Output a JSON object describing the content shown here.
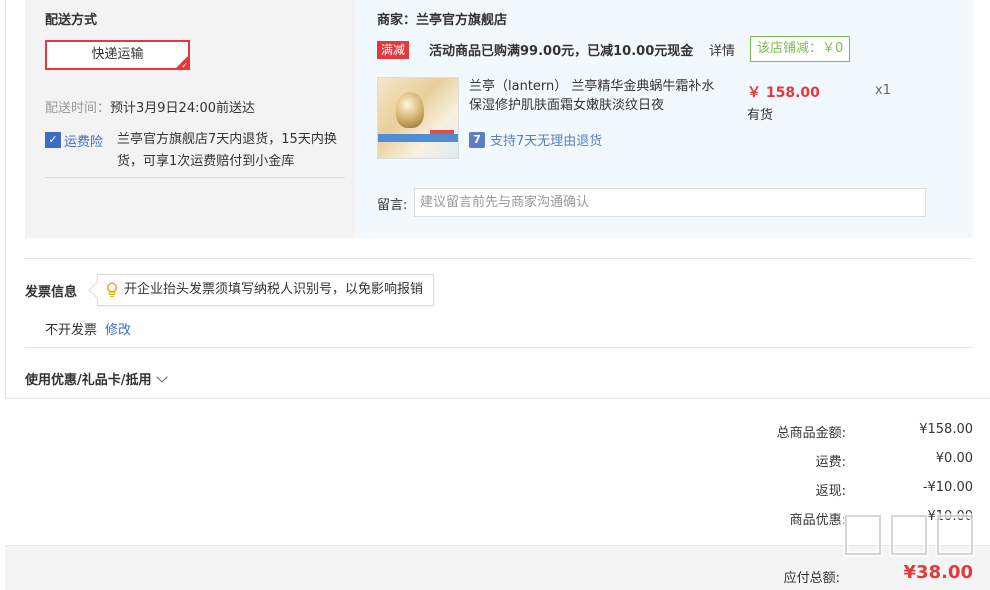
{
  "delivery": {
    "title": "配送方式",
    "method_label": "快递运输",
    "time_label": "配送时间：",
    "time_value": "预计3月9日24:00前送达",
    "insurance_label": "运费险",
    "insurance_desc": "兰亭官方旗舰店7天内退货，15天内换货，可享1次运费赔付到小金库"
  },
  "shop": {
    "label": "商家：兰亭官方旗舰店",
    "promo_tag": "满减",
    "promo_text": "活动商品已购满99.00元，已减10.00元现金",
    "promo_detail": "详情",
    "shop_discount": "该店铺减：￥0"
  },
  "product": {
    "name": "兰亭（lantern） 兰亭精华金典蜗牛霜补水保湿修护肌肤面霜女嫩肤淡纹日夜",
    "price": "￥ 158.00",
    "stock": "有货",
    "quantity": "x1",
    "return_policy": "支持7天无理由退货",
    "return_icon": "7"
  },
  "message": {
    "label": "留言:",
    "placeholder": "建议留言前先与商家沟通确认"
  },
  "invoice": {
    "title": "发票信息",
    "tip": "开企业抬头发票须填写纳税人识别号，以免影响报销",
    "value": "不开发票",
    "edit_label": "修改"
  },
  "coupon": {
    "label": "使用优惠/礼品卡/抵用"
  },
  "summary": {
    "rows": [
      {
        "label": "总商品金额:",
        "value": "¥158.00"
      },
      {
        "label": "运费:",
        "value": "¥0.00"
      },
      {
        "label": "返现:",
        "value": "-¥10.00"
      },
      {
        "label": "商品优惠:",
        "value": "¥10.00"
      }
    ],
    "pay_label": "应付总额:",
    "pay_value": "¥38.00"
  },
  "colors": {
    "accent_red": "#e4393c",
    "link_blue": "#3b6dc6",
    "discount_green": "#7abd54"
  }
}
